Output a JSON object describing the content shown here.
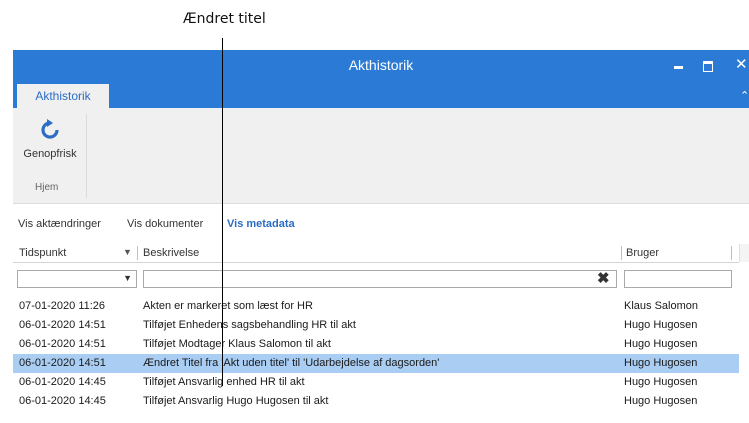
{
  "callout": {
    "label": "Ændret titel"
  },
  "window": {
    "title": "Akthistorik",
    "minimize_icon": "minimize-icon",
    "maximize_icon": "maximize-icon",
    "close_icon": "close-icon",
    "title_color": "#2b7bd6"
  },
  "ribbon": {
    "tab_label": "Akthistorik",
    "refresh_label": "Genopfrisk",
    "refresh_icon": "refresh-icon",
    "group_label": "Hjem"
  },
  "view_tabs": [
    {
      "label": "Vis aktændringer"
    },
    {
      "label": "Vis dokumenter"
    },
    {
      "label": "Vis metadata",
      "active": true
    }
  ],
  "table": {
    "columns": {
      "time": "Tidspunkt",
      "description": "Beskrivelse",
      "user": "Bruger"
    },
    "rows": [
      {
        "time": "07-01-2020 11:26",
        "description": "Akten er markeret som læst for HR",
        "user": "Klaus Salomon"
      },
      {
        "time": "06-01-2020 14:51",
        "description": "Tilføjet Enhedens sagsbehandling HR til akt",
        "user": "Hugo Hugosen"
      },
      {
        "time": "06-01-2020 14:51",
        "description": "Tilføjet Modtager Klaus Salomon til akt",
        "user": "Hugo Hugosen"
      },
      {
        "time": "06-01-2020 14:51",
        "description": "Ændret Titel fra 'Akt uden titel' til 'Udarbejdelse af dagsorden'",
        "user": "Hugo Hugosen",
        "selected": true
      },
      {
        "time": "06-01-2020 14:45",
        "description": "Tilføjet Ansvarlig enhed HR til akt",
        "user": "Hugo Hugosen"
      },
      {
        "time": "06-01-2020 14:45",
        "description": "Tilføjet Ansvarlig Hugo Hugosen til akt",
        "user": "Hugo Hugosen"
      }
    ]
  }
}
